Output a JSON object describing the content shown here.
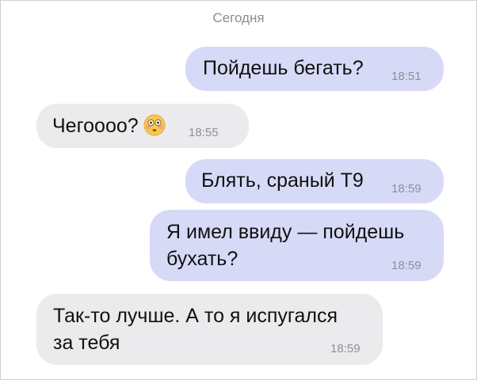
{
  "chat": {
    "date_separator": "Сегодня",
    "messages": [
      {
        "direction": "outgoing",
        "text": "Пойдешь бегать?",
        "time": "18:51"
      },
      {
        "direction": "incoming",
        "text": "Чегоооо?",
        "emoji": "flushed-face-icon",
        "time": "18:55"
      },
      {
        "direction": "outgoing",
        "text": "Блять, сраный Т9",
        "time": "18:59"
      },
      {
        "direction": "outgoing",
        "text": "Я имел ввиду — пойдешь\nбухать?",
        "time": "18:59"
      },
      {
        "direction": "incoming",
        "text": "Так-то лучше. А то я испугался\nза тебя",
        "time": "18:59"
      }
    ]
  },
  "colors": {
    "outgoing_bubble": "#d7daf7",
    "incoming_bubble": "#ebebee",
    "timestamp": "#8e8e96",
    "date_separator": "#8c8c93"
  }
}
